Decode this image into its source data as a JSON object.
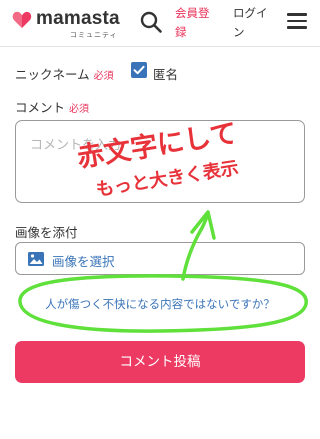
{
  "header": {
    "logo_text": "mamasta",
    "logo_sub": "コミュニティ",
    "signup_label": "会員登録",
    "login_label": "ログイン"
  },
  "form": {
    "nickname_label": "ニックネーム",
    "required_label": "必須",
    "anonymous_label": "匿名",
    "anonymous_checked": true,
    "comment_label": "コメント",
    "comment_placeholder": "コメントを入力",
    "image_label": "画像を添付",
    "image_button_label": "画像を選択",
    "warning_text": "人が傷つく不快になる内容ではないですか？",
    "submit_label": "コメント投稿"
  },
  "annotation": {
    "line1": "赤文字にして",
    "line2": "もっと大きく表示"
  },
  "colors": {
    "brand_pink": "#ec3a62",
    "link_blue": "#3a74b8",
    "annotation_red": "#e8323a",
    "annotation_green": "#5fe03a"
  }
}
